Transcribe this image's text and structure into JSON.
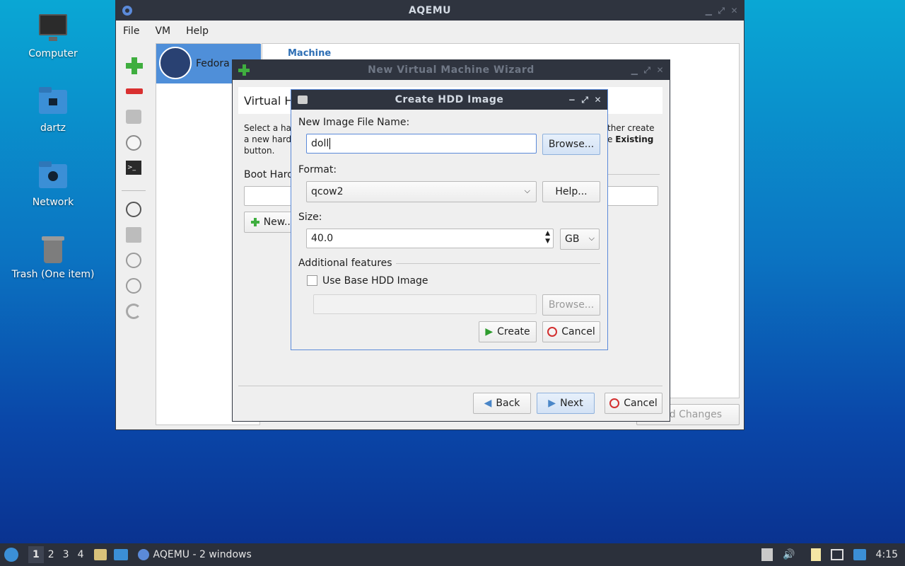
{
  "desktop": {
    "icons": [
      {
        "label": "Computer"
      },
      {
        "label": "dartz"
      },
      {
        "label": "Network"
      },
      {
        "label": "Trash (One item)"
      }
    ]
  },
  "aqemu": {
    "title": "AQEMU",
    "menu": [
      "File",
      "VM",
      "Help"
    ],
    "vm_name": "Fedora",
    "section_title": "Machine",
    "discard_label": "card Changes"
  },
  "wizard": {
    "title": "New Virtual Machine Wizard",
    "heading": "Virtual Ha",
    "desc_line1": "Select a har",
    "desc_line2": "a new hard",
    "desc_line3": "button.",
    "desc_right1": "ther create",
    "desc_right2": "e ",
    "desc_right2_bold": "Existing",
    "boot_label": "Boot Hard",
    "new_button": "New...",
    "back": "Back",
    "next": "Next",
    "cancel": "Cancel"
  },
  "hdd": {
    "title": "Create HDD Image",
    "file_label": "New Image File Name:",
    "file_value": "doll",
    "browse": "Browse...",
    "format_label": "Format:",
    "format_value": "qcow2",
    "help": "Help...",
    "size_label": "Size:",
    "size_value": "40.0",
    "unit_value": "GB",
    "additional": "Additional features",
    "use_base": "Use Base HDD Image",
    "browse2": "Browse...",
    "create": "Create",
    "cancel": "Cancel"
  },
  "taskbar": {
    "workspaces": [
      "1",
      "2",
      "3",
      "4"
    ],
    "task_label": "AQEMU - 2 windows",
    "clock": "4:15"
  }
}
